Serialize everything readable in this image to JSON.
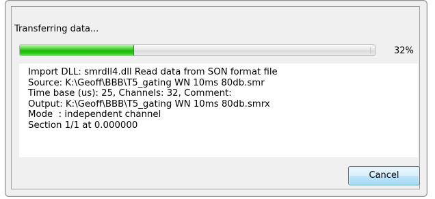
{
  "dialog": {
    "status_text": "Transferring data...",
    "progress": {
      "percent_label": "32%",
      "fraction": 0.32
    },
    "log_lines": [
      "Import DLL: smrdll4.dll Read data from SON format file",
      "Source: K:\\Geoff\\BBB\\T5_gating WN 10ms 80db.smr",
      "Time base (us): 25, Channels: 32, Comment:",
      "Output: K:\\Geoff\\BBB\\T5_gating WN 10ms 80db.smrx",
      "Mode  : independent channel",
      "Section 1/1 at 0.000000"
    ],
    "cancel_label": "Cancel"
  },
  "colors": {
    "progress_fill": "#1fb80d",
    "button_border": "#3c7fb1",
    "dialog_bg": "#f0f0f0"
  }
}
